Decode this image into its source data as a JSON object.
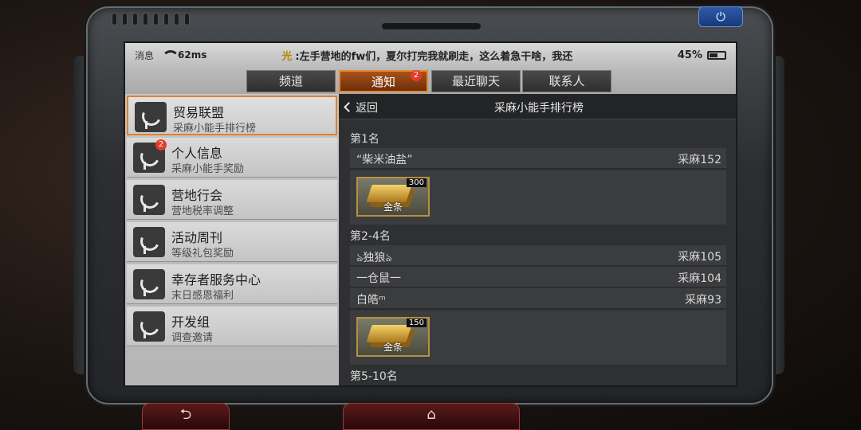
{
  "status": {
    "message_label": "消息",
    "ping": "62ms",
    "ticker_icon": "光",
    "ticker_text": ":左手营地的fw们，夏尔打完我就刷走，这么着急干啥，我还",
    "battery": "45%"
  },
  "tabs": [
    {
      "label": "频道",
      "badge": ""
    },
    {
      "label": "通知",
      "badge": "2"
    },
    {
      "label": "最近聊天",
      "badge": ""
    },
    {
      "label": "联系人",
      "badge": ""
    }
  ],
  "sidebar": {
    "items": [
      {
        "title": "贸易联盟",
        "sub": "采麻小能手排行榜",
        "badge": ""
      },
      {
        "title": "个人信息",
        "sub": "采麻小能手奖励",
        "badge": "2"
      },
      {
        "title": "营地行会",
        "sub": "营地税率调整",
        "badge": ""
      },
      {
        "title": "活动周刊",
        "sub": "等级礼包奖励",
        "badge": ""
      },
      {
        "title": "幸存者服务中心",
        "sub": "末日感恩福利",
        "badge": ""
      },
      {
        "title": "开发组",
        "sub": "调查邀请",
        "badge": ""
      }
    ]
  },
  "content": {
    "back_label": "返回",
    "title": "采麻小能手排行榜",
    "group1": {
      "heading": "第1名",
      "rows": [
        {
          "name": "“柴米油盐”",
          "score": "采麻152"
        }
      ],
      "reward": {
        "name": "金条",
        "qty": "300"
      }
    },
    "group2": {
      "heading": "第2-4名",
      "rows": [
        {
          "name": "ঌ独狼ঌ",
          "score": "采麻105"
        },
        {
          "name": "一仓鼠一",
          "score": "采麻104"
        },
        {
          "name": "白皓ᵐ",
          "score": "采麻93"
        }
      ],
      "reward": {
        "name": "金条",
        "qty": "150"
      }
    },
    "group3": {
      "heading": "第5-10名"
    }
  },
  "buttons": {
    "back_symbol": "⮌",
    "home_symbol": "⌂",
    "power_symbol": "⏻"
  }
}
